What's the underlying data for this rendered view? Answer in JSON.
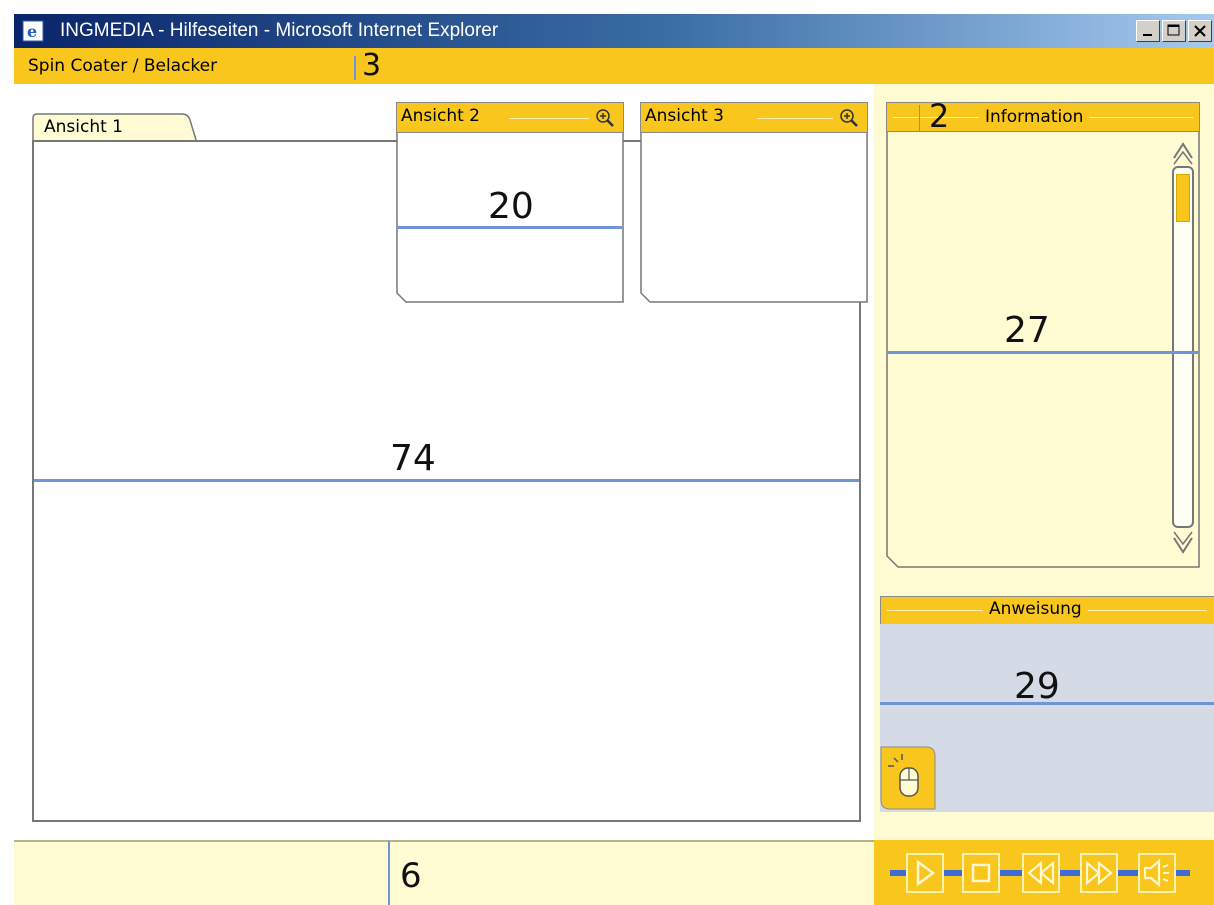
{
  "window": {
    "title": "INGMEDIA - Hilfeseiten - Microsoft Internet Explorer"
  },
  "header": {
    "section_title": "Spin Coater / Belacker",
    "annotation": "3"
  },
  "views": {
    "ansicht1": {
      "label": "Ansicht 1",
      "annotation": "74"
    },
    "ansicht2": {
      "label": "Ansicht 2",
      "annotation": "20"
    },
    "ansicht3": {
      "label": "Ansicht 3"
    }
  },
  "information": {
    "title": "Information",
    "header_annotation": "2",
    "annotation": "27"
  },
  "anweisung": {
    "title": "Anweisung",
    "annotation": "29"
  },
  "footer": {
    "annotation": "6"
  },
  "controls": [
    "play",
    "stop",
    "rewind",
    "fast-forward",
    "volume"
  ],
  "colors": {
    "accent": "#f9c61e",
    "panel_bg": "#fffbd2",
    "ruler": "#6f95d8",
    "instruction_bg": "#d5dbe6"
  }
}
